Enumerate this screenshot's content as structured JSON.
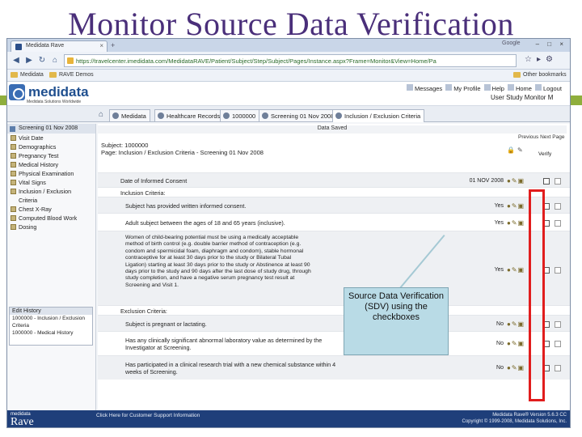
{
  "slide": {
    "title": "Monitor Source Data Verification"
  },
  "browser": {
    "tab_title": "Medidata Rave",
    "new_tab": "+",
    "brand": "Google",
    "window_controls": "– □ ×",
    "url": "https://travelcenter.imedidata.com/MedidataRAVE/Patient/Subject/Step/Subject/Pages/Instance.aspx?Frame=Monitor&View=Home/Pa",
    "bookmarks": [
      "Medidata",
      "RAVE Demos"
    ],
    "other_bookmarks": "Other bookmarks"
  },
  "app": {
    "logo": "medidata",
    "logo_sub": "Medidata Solutions Worldwide",
    "user_menu": [
      "Messages",
      "My Profile",
      "Help",
      "Home",
      "Logout"
    ],
    "role_line": "User Study Monitor M"
  },
  "crumbs": [
    {
      "label": "Medidata"
    },
    {
      "label": "Healthcare Records"
    },
    {
      "label": "1000000"
    },
    {
      "label": "Screening 01 Nov 2008"
    },
    {
      "label": "Inclusion / Exclusion Criteria"
    }
  ],
  "left_panel": {
    "header": "Screening 01 Nov 2008",
    "items": [
      "Visit Date",
      "Demographics",
      "Pregnancy Test",
      "Medical History",
      "Physical Examination",
      "Vital Signs",
      "Inclusion / Exclusion",
      "Criteria",
      "Chest X-Ray",
      "Computed Blood Work",
      "Dosing"
    ],
    "history_title": "Edit History",
    "history_items": [
      "1000000 - Inclusion / Exclusion",
      "Criteria",
      "1000000 - Medical History"
    ]
  },
  "main": {
    "saved": "Data Saved",
    "prev_next": "Previous  Next  Page",
    "subject": "Subject: 1000000",
    "page": "Page: Inclusion / Exclusion Criteria - Screening 01 Nov 2008",
    "verify": "Verify",
    "rows": [
      {
        "q": "Date of Informed Consent",
        "ans": "01 NOV 2008"
      },
      {
        "q": "Inclusion Criteria:",
        "ans": ""
      },
      {
        "q": "Subject has provided written informed consent.",
        "ans": "Yes"
      },
      {
        "q": "Adult subject between the ages of 18 and 65 years (inclusive).",
        "ans": "Yes"
      },
      {
        "q": "Women of child-bearing potential must be using a medically acceptable method of birth control (e.g. double barrier method of contraception (e.g. condom and spermicidal foam, diaphragm and condom), stable hormonal contraceptive for at least 30 days prior to the study or Bilateral Tubal Ligation) starting at least 30 days prior to the study or Abstinence at least 90 days prior to the study and 90 days after the last dose of study drug, through study completion, and have a negative serum pregnancy test result at Screening and Visit 1.",
        "ans": "Yes"
      },
      {
        "q": "Exclusion Criteria:",
        "ans": ""
      },
      {
        "q": "Subject is pregnant or lactating.",
        "ans": "No"
      },
      {
        "q": "Has any clinically significant abnormal laboratory value as determined by the Investigator at Screening.",
        "ans": "No"
      },
      {
        "q": "Has participated in a clinical research trial with a new chemical substance within 4 weeks of Screening.",
        "ans": "No"
      }
    ]
  },
  "callout": {
    "text": "Source Data Verification (SDV) using the checkboxes"
  },
  "footer": {
    "logo_top": "medidata",
    "logo_rave": "Rave",
    "help": "Click Here for Customer Support Information",
    "version": "Medidata Rave® Version 5.6.3 CC",
    "copyright": "Copyright © 1999-2008, Medidata Solutions, Inc."
  }
}
